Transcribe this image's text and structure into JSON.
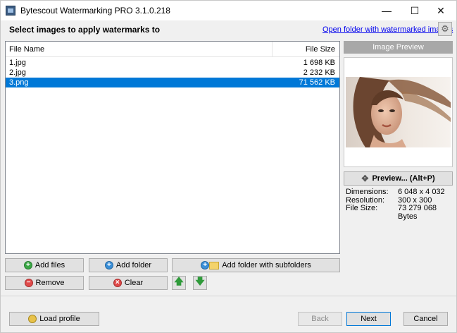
{
  "window": {
    "title": "Bytescout Watermarking PRO 3.1.0.218",
    "minimize_icon": "minimize-icon",
    "maximize_icon": "maximize-icon",
    "close_icon": "close-icon"
  },
  "header": {
    "instruction": "Select images to apply watermarks to",
    "open_folder_link": "Open folder with watermarked images",
    "settings_icon": "gear-icon"
  },
  "file_list": {
    "columns": [
      "File Name",
      "File Size"
    ],
    "rows": [
      {
        "name": "1.jpg",
        "size": "1 698 KB",
        "selected": false
      },
      {
        "name": "2.jpg",
        "size": "2 232 KB",
        "selected": false
      },
      {
        "name": "3.png",
        "size": "71 562 KB",
        "selected": true
      }
    ]
  },
  "buttons": {
    "add_files": "Add files",
    "add_folder": "Add folder",
    "add_folder_sub": "Add folder with subfolders",
    "remove": "Remove",
    "clear": "Clear",
    "move_up_icon": "arrow-up-icon",
    "move_down_icon": "arrow-down-icon"
  },
  "preview": {
    "header": "Image Preview",
    "button": "Preview... (Alt+P)",
    "info": [
      {
        "label": "Dimensions:",
        "value": "6 048 x 4 032"
      },
      {
        "label": "Resolution:",
        "value": "300 x 300"
      },
      {
        "label": "File Size:",
        "value": "73 279 068 Bytes"
      }
    ]
  },
  "footer": {
    "load_profile": "Load profile",
    "back": "Back",
    "next": "Next",
    "cancel": "Cancel"
  },
  "colors": {
    "selection": "#0078d7",
    "link": "#0000ee",
    "preview_header": "#a8a8a8"
  }
}
